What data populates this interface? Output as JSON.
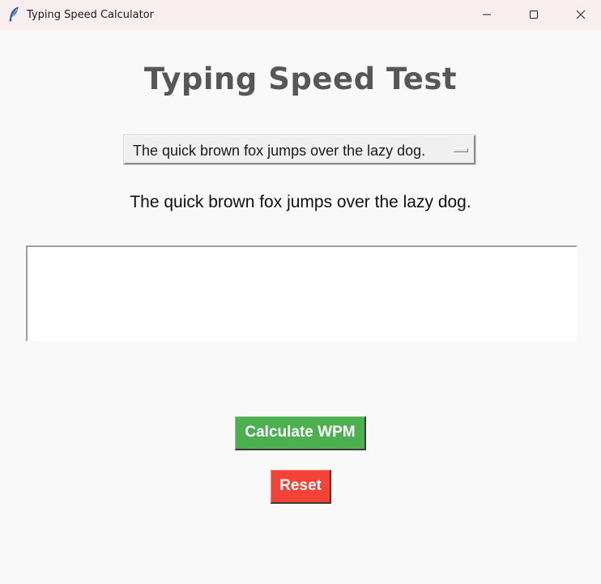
{
  "window": {
    "title": "Typing Speed Calculator",
    "icon": "feather-icon",
    "controls": [
      "minimize-icon",
      "maximize-icon",
      "close-icon"
    ]
  },
  "main": {
    "heading": "Typing Speed Test",
    "sentence_select": {
      "selected": "The quick brown fox jumps over the lazy dog."
    },
    "sentence_display": "The quick brown fox jumps over the lazy dog.",
    "typing_input": {
      "value": ""
    },
    "calculate_button": "Calculate WPM",
    "reset_button": "Reset"
  },
  "colors": {
    "background": "#f9f9f9",
    "titlebar": "#f9eeef",
    "heading": "#575757",
    "calculate": "#4caf50",
    "reset": "#f44336"
  }
}
